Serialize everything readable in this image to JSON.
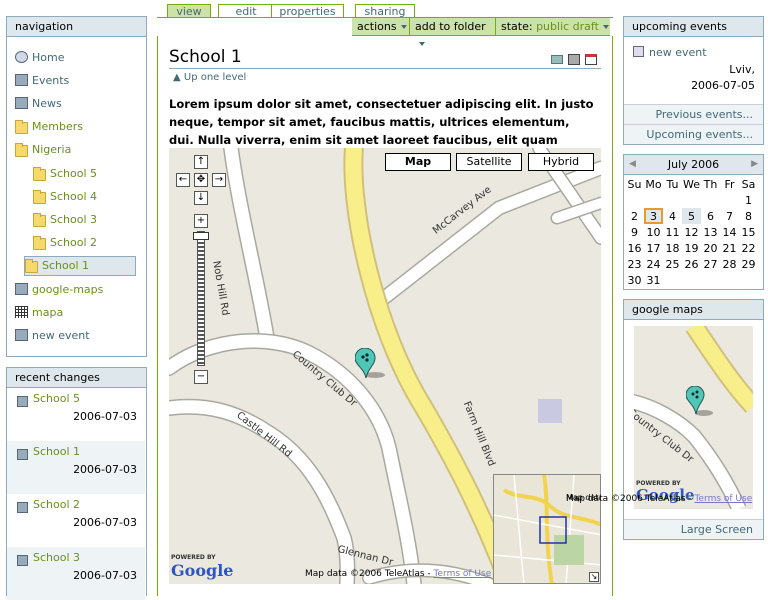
{
  "navigation": {
    "title": "navigation",
    "items": [
      {
        "label": "Home",
        "icon": "home-icon"
      },
      {
        "label": "Events",
        "icon": "events-icon"
      },
      {
        "label": "News",
        "icon": "news-icon"
      },
      {
        "label": "Members",
        "icon": "folder-icon"
      },
      {
        "label": "Nigeria",
        "icon": "folder-icon"
      },
      {
        "label": "School 5",
        "icon": "folder-icon"
      },
      {
        "label": "School 4",
        "icon": "folder-icon"
      },
      {
        "label": "School 3",
        "icon": "folder-icon"
      },
      {
        "label": "School 2",
        "icon": "folder-icon"
      },
      {
        "label": "School 1",
        "icon": "folder-icon"
      },
      {
        "label": "google-maps",
        "icon": "map-icon"
      },
      {
        "label": "mapa",
        "icon": "grid-icon"
      },
      {
        "label": "new event",
        "icon": "event-icon"
      }
    ]
  },
  "recent": {
    "title": "recent changes",
    "items": [
      {
        "label": "School 5",
        "date": "2006-07-03"
      },
      {
        "label": "School 1",
        "date": "2006-07-03"
      },
      {
        "label": "School 2",
        "date": "2006-07-03"
      },
      {
        "label": "School 3",
        "date": "2006-07-03"
      }
    ]
  },
  "tabs": {
    "view": "view",
    "edit": "edit",
    "properties": "properties",
    "sharing": "sharing"
  },
  "actions": {
    "actions": "actions",
    "add_folder": "add to folder",
    "state_label": "state:",
    "state_value": "public draft"
  },
  "content": {
    "title": "School 1",
    "up": "Up one level",
    "description": "Lorem ipsum dolor sit amet, consectetuer adipiscing elit. In justo neque, tempor sit amet, faucibus mattis, ultrices elementum, dui. Nulla viverra, enim sit amet laoreet faucibus, elit quam congue ipsum."
  },
  "map": {
    "buttons": {
      "map": "Map",
      "satellite": "Satellite",
      "hybrid": "Hybrid"
    },
    "streets": {
      "nob": "Nob Hill Rd",
      "mccarvey": "McCarvey Ave",
      "country": "Country Club Dr",
      "castle": "Castle Hill Rd",
      "farm": "Farm Hill Blvd",
      "glennan": "Glennan Dr"
    },
    "powered": "POWERED BY",
    "google": "Google",
    "mapdata": "Map data ©2006 TeleAtlas -",
    "terms": "Terms of Use",
    "overview_data": "Map data ©2006 TeleAtlas -"
  },
  "events": {
    "title": "upcoming events",
    "item": "new event",
    "location": "Lviv,",
    "date": "2006-07-05",
    "prev": "Previous events...",
    "upcoming": "Upcoming events..."
  },
  "calendar": {
    "month": "July 2006",
    "days": [
      "Su",
      "Mo",
      "Tu",
      "We",
      "Th",
      "Fr",
      "Sa"
    ],
    "weeks": [
      [
        "",
        "",
        "",
        "",
        "",
        "",
        "1"
      ],
      [
        "2",
        "3",
        "4",
        "5",
        "6",
        "7",
        "8"
      ],
      [
        "9",
        "10",
        "11",
        "12",
        "13",
        "14",
        "15"
      ],
      [
        "16",
        "17",
        "18",
        "19",
        "20",
        "21",
        "22"
      ],
      [
        "23",
        "24",
        "25",
        "26",
        "27",
        "28",
        "29"
      ],
      [
        "30",
        "31",
        "",
        "",
        "",
        "",
        ""
      ]
    ],
    "today": "3",
    "event_day": "5"
  },
  "gmaps": {
    "title": "google maps",
    "street": "Country Club Dr",
    "powered": "POWERED BY",
    "google": "Google",
    "mapdata": "Map data ©2006 TeleAtlas -",
    "terms": "Terms of Use",
    "large": "Large Screen"
  }
}
